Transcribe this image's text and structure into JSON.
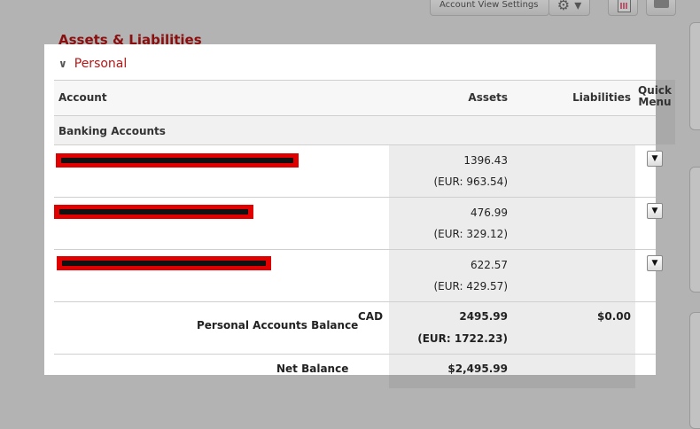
{
  "toolbar": {
    "account_view_settings": "Account View Settings",
    "gear_symbol": "⚙ ▾"
  },
  "section_title": "Assets & Liabilities",
  "group": {
    "chevron": "∨",
    "title": "Personal"
  },
  "table": {
    "headers": {
      "account": "Account",
      "assets": "Assets",
      "liabilities": "Liabilities",
      "quick_menu": "Quick Menu"
    },
    "category": "Banking Accounts",
    "rows": [
      {
        "amount": "1396.43",
        "eur": "(EUR: 963.54)"
      },
      {
        "amount": "476.99",
        "eur": "(EUR: 329.12)"
      },
      {
        "amount": "622.57",
        "eur": "(EUR: 429.57)"
      }
    ],
    "dropdown_symbol": "▼",
    "balance": {
      "label": "Personal Accounts Balance",
      "currency": "CAD",
      "assets": "2495.99",
      "assets_eur": "(EUR: 1722.23)",
      "liabilities": "$0.00"
    },
    "net": {
      "label": "Net Balance",
      "value": "$2,495.99"
    }
  },
  "colors": {
    "section_title": "#8b0f0f",
    "group_title": "#b01818",
    "redaction": "#e00000"
  }
}
